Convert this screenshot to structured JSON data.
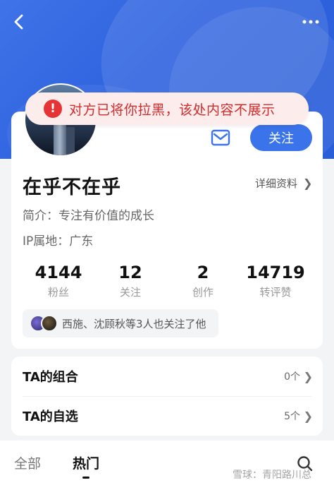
{
  "header": {
    "back_icon": "chevron-left-icon",
    "more_icon": "more-dots-icon"
  },
  "toast": {
    "icon": "alert-circle-icon",
    "icon_glyph": "!",
    "text": "对方已将你拉黑，该处内容不展示",
    "color": "#d22c2c"
  },
  "profile": {
    "name": "在乎不在乎",
    "detail_label": "详细资料",
    "bio": "简介：专注有价值的成长",
    "ip": "IP属地：广东",
    "follow_label": "关注",
    "mail_icon": "mail-icon"
  },
  "stats": [
    {
      "value": "4144",
      "label": "粉丝"
    },
    {
      "value": "12",
      "label": "关注"
    },
    {
      "value": "2",
      "label": "创作"
    },
    {
      "value": "14719",
      "label": "转评赞"
    }
  ],
  "mutual": {
    "text": "西施、沈顾秋等3人也关注了他"
  },
  "lists": [
    {
      "title": "TA的组合",
      "count": "0个"
    },
    {
      "title": "TA的自选",
      "count": "5个"
    }
  ],
  "tabs": [
    {
      "label": "全部",
      "active": false
    },
    {
      "label": "热门",
      "active": true
    }
  ],
  "search_icon": "search-icon",
  "watermark": "雪球：青阳路川总",
  "colors": {
    "accent": "#3a73ea",
    "header_blue": "#2f63df",
    "alert_red": "#e63434"
  }
}
